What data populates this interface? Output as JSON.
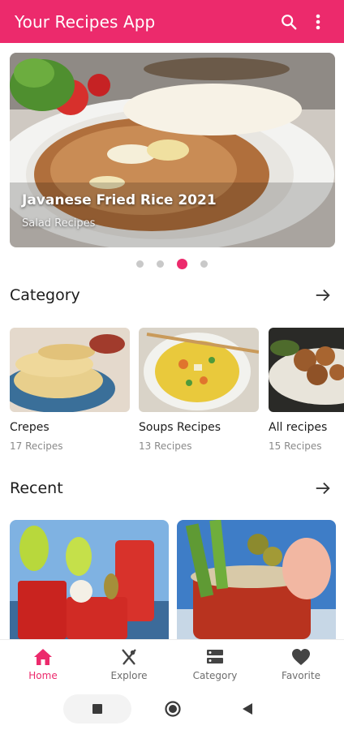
{
  "app": {
    "title": "Your Recipes App"
  },
  "hero": {
    "title": "Javanese Fried Rice 2021",
    "subtitle": "Salad Recipes",
    "active_dot": 3,
    "dot_count": 4
  },
  "category": {
    "heading": "Category",
    "items": [
      {
        "name": "Crepes",
        "count": "17 Recipes"
      },
      {
        "name": "Soups Recipes",
        "count": "13 Recipes"
      },
      {
        "name": "All recipes",
        "count": "15 Recipes"
      }
    ]
  },
  "recent": {
    "heading": "Recent"
  },
  "bottom_nav": {
    "items": [
      {
        "label": "Home",
        "icon": "home-icon",
        "active": true
      },
      {
        "label": "Explore",
        "icon": "fork-knife-icon",
        "active": false
      },
      {
        "label": "Category",
        "icon": "category-list-icon",
        "active": false
      },
      {
        "label": "Favorite",
        "icon": "heart-icon",
        "active": false
      }
    ]
  },
  "colors": {
    "accent": "#ec2a6c",
    "inactive": "#6d6d6d",
    "muted_text": "#8a8a8a"
  }
}
